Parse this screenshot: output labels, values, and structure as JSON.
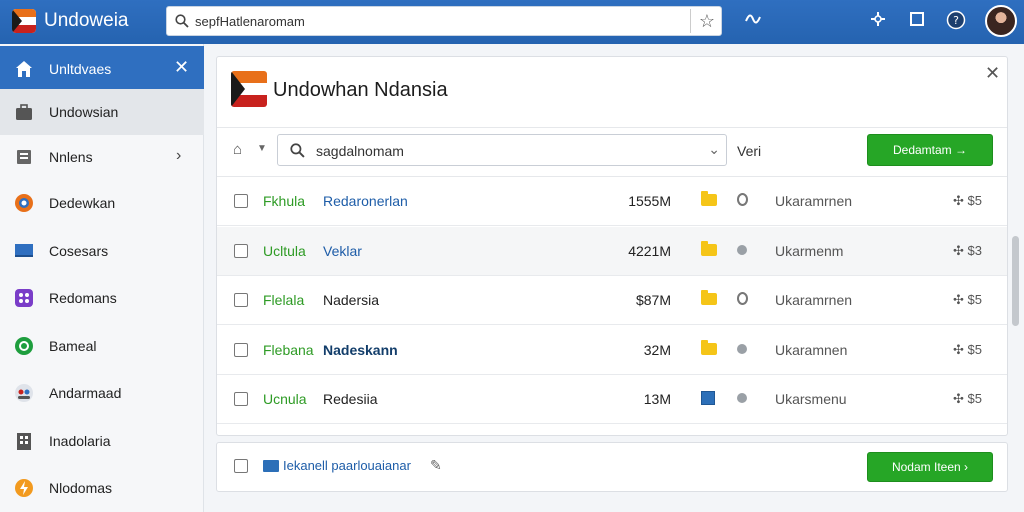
{
  "app": {
    "title": "Undoweia"
  },
  "search": {
    "value": "sepfHatlenaromam"
  },
  "sidebar": {
    "items": [
      {
        "label": "Unltdvaes",
        "icon": "home-icon",
        "state": "active"
      },
      {
        "label": "Undowsian",
        "icon": "briefcase-icon",
        "state": "selected"
      },
      {
        "label": "Nnlens",
        "icon": "document-icon",
        "state": "normal"
      },
      {
        "label": "Dedewkan",
        "icon": "browser-icon",
        "state": "normal"
      },
      {
        "label": "Cosesars",
        "icon": "monitor-icon",
        "state": "normal"
      },
      {
        "label": "Redomans",
        "icon": "apps-icon",
        "state": "normal"
      },
      {
        "label": "Bameal",
        "icon": "shield-icon",
        "state": "normal"
      },
      {
        "label": "Andarmaad",
        "icon": "people-icon",
        "state": "normal"
      },
      {
        "label": "Inadolaria",
        "icon": "building-icon",
        "state": "normal"
      },
      {
        "label": "Nlodomas",
        "icon": "lightning-icon",
        "state": "normal"
      }
    ]
  },
  "panel": {
    "title": "Undowhan Ndansia",
    "filter_value": "sagdalnomam",
    "view_label": "Veri",
    "primary_button": "Dedamtam →"
  },
  "rows": [
    {
      "status": "Fkhula",
      "name": "Redaronerlan",
      "size": "1555M",
      "type": "folder",
      "indicator": "ring",
      "owner": "Ukaramrnen",
      "action": "✣ $5",
      "name_style": "link",
      "highlight": false
    },
    {
      "status": "Ucltula",
      "name": "Veklar",
      "size": "4221M",
      "type": "folder",
      "indicator": "dot",
      "owner": "Ukarmenm",
      "action": "✣ $3",
      "name_style": "link",
      "highlight": true
    },
    {
      "status": "Flelala",
      "name": "Nadersia",
      "size": "$87M",
      "type": "folder",
      "indicator": "ring",
      "owner": "Ukaramrnen",
      "action": "✣ $5",
      "name_style": "plain",
      "highlight": false
    },
    {
      "status": "Flebana",
      "name": "Nadeskann",
      "size": "32M",
      "type": "folder",
      "indicator": "dot",
      "owner": "Ukaramnen",
      "action": "✣ $5",
      "name_style": "bold",
      "highlight": false
    },
    {
      "status": "Ucnula",
      "name": "Redesiia",
      "size": "13M",
      "type": "file",
      "indicator": "dot",
      "owner": "Ukarsmenu",
      "action": "✣ $5",
      "name_style": "plain",
      "highlight": false
    }
  ],
  "footer": {
    "text": "Iekanell paarlouaianar",
    "button": "Nodam Iteen ›"
  },
  "colors": {
    "header": "#2f6fc0",
    "accent_green": "#26a626",
    "folder": "#f5c518"
  }
}
